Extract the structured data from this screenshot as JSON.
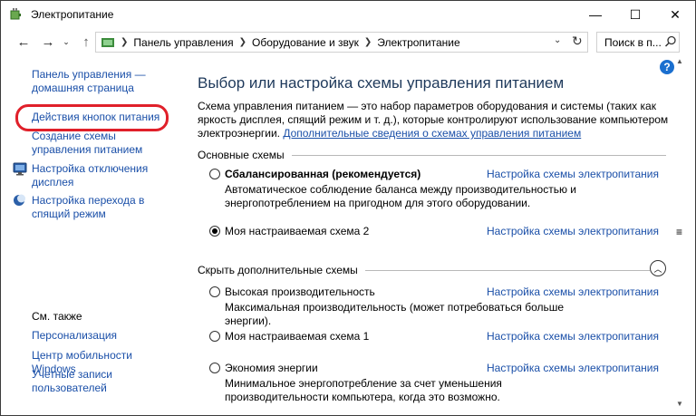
{
  "window": {
    "title": "Электропитание",
    "minimize": "—",
    "maximize": "☐",
    "close": "✕"
  },
  "nav": {
    "back": "←",
    "forward": "→",
    "recent": "⌄",
    "up": "↑",
    "breadcrumb": [
      "Панель управления",
      "Оборудование и звук",
      "Электропитание"
    ],
    "dropdown": "⌄",
    "refresh": "↻",
    "search_placeholder": "Поиск в п..."
  },
  "sidebar": {
    "home_link": "Панель управления — домашняя страница",
    "links": [
      {
        "label": "Действия кнопок питания",
        "highlighted": true
      },
      {
        "label": "Создание схемы управления питанием"
      },
      {
        "label": "Настройка отключения дисплея",
        "icon": "monitor-icon"
      },
      {
        "label": "Настройка перехода в спящий режим",
        "icon": "moon-icon"
      }
    ],
    "see_also_title": "См. также",
    "see_also": [
      {
        "label": "Персонализация"
      },
      {
        "label": "Центр мобильности Windows"
      },
      {
        "label": "Учетные записи пользователей"
      }
    ]
  },
  "main": {
    "help": "?",
    "title": "Выбор или настройка схемы управления питанием",
    "description": "Схема управления питанием — это набор параметров оборудования и системы (таких как яркость дисплея, спящий режим и т. д.), которые контролируют использование компьютером электроэнергии.",
    "description_link": "Дополнительные сведения о схемах управления питанием",
    "group_main": "Основные схемы",
    "group_hidden": "Скрыть дополнительные схемы",
    "collapse": "︿",
    "plans": [
      {
        "name": "Сбалансированная (рекомендуется)",
        "bold": true,
        "selected": false,
        "link": "Настройка схемы электропитания",
        "description": "Автоматическое соблюдение баланса между производительностью и энергопотреблением на пригодном для этого оборудовании."
      },
      {
        "name": "Моя настраиваемая схема 2",
        "bold": false,
        "selected": true,
        "link": "Настройка схемы электропитания",
        "description": ""
      },
      {
        "name": "Высокая производительность",
        "bold": false,
        "selected": false,
        "link": "Настройка схемы электропитания",
        "description": "Максимальная производительность (может потребоваться больше энергии)."
      },
      {
        "name": "Моя настраиваемая схема 1",
        "bold": false,
        "selected": false,
        "link": "Настройка схемы электропитания",
        "description": ""
      },
      {
        "name": "Экономия энергии",
        "bold": false,
        "selected": false,
        "link": "Настройка схемы электропитания",
        "description": "Минимальное энергопотребление за счет уменьшения производительности компьютера, когда это возможно."
      }
    ]
  },
  "scrollbar": {
    "up": "▲",
    "thumb": "≡",
    "down": "▼"
  },
  "colors": {
    "link": "#1a4fa8",
    "title": "#1e395b",
    "highlight_ring": "#e0202a",
    "help": "#1a6fcf"
  }
}
